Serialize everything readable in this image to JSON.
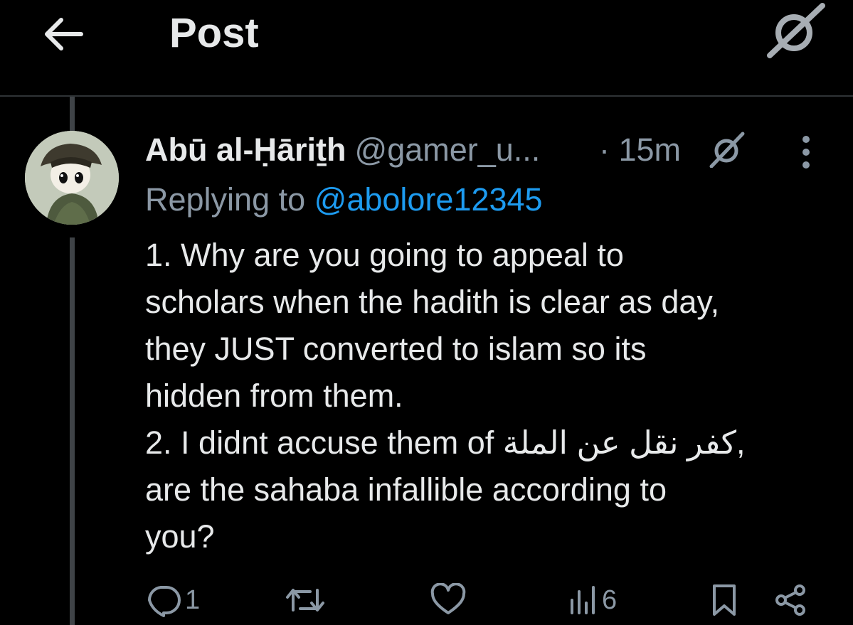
{
  "header": {
    "title": "Post",
    "back_icon": "arrow-left-icon",
    "grok_icon": "grok-icon"
  },
  "post": {
    "display_name": "Abū al-Ḥāriṯh",
    "handle": "@gamer_u...",
    "time": "· 15m",
    "replying_prefix": "Replying to",
    "replying_to": "@abolore12345",
    "text_lines": [
      "1. Why are you going to appeal to",
      "scholars when the hadith is clear as day,",
      "they JUST converted to islam so its",
      "hidden from them.",
      "2. I didnt accuse them of كفر نقل عن الملة,",
      "are the sahaba infallible according to",
      "you?"
    ]
  },
  "actions": {
    "reply_count": "1",
    "retweet_count": "",
    "like_count": "",
    "views_count": "6"
  },
  "colors": {
    "background": "#000000",
    "text": "#e7e9ea",
    "muted": "#8b98a5",
    "link": "#1d9bf0"
  }
}
